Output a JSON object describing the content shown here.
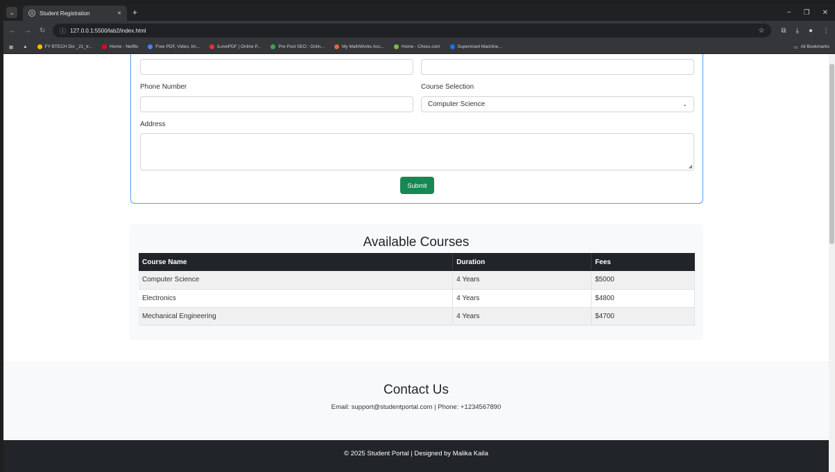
{
  "browser": {
    "tab_title": "Student Registration",
    "url": "127.0.0.1:5500/lab2/index.html",
    "bookmarks": [
      {
        "label": "FY BTECH Div _21_tr...",
        "color": "#fbbc04"
      },
      {
        "label": "Home - Netflix",
        "color": "#e50914"
      },
      {
        "label": "Free PDF, Video, Im...",
        "color": "#4285f4"
      },
      {
        "label": "iLovePDF | Online P...",
        "color": "#e5322d"
      },
      {
        "label": "Pre Post SEO : Onlin...",
        "color": "#34a853"
      },
      {
        "label": "My MathWorks Acc...",
        "color": "#e16737"
      },
      {
        "label": "Home - Chess.com",
        "color": "#81b64c"
      },
      {
        "label": "Supervised Machine...",
        "color": "#1a73e8"
      }
    ],
    "all_bookmarks": "All Bookmarks"
  },
  "form": {
    "phone_label": "Phone Number",
    "course_label": "Course Selection",
    "course_selected": "Computer Science",
    "address_label": "Address",
    "submit_label": "Submit"
  },
  "courses": {
    "title": "Available Courses",
    "headers": [
      "Course Name",
      "Duration",
      "Fees"
    ],
    "rows": [
      [
        "Computer Science",
        "4 Years",
        "$5000"
      ],
      [
        "Electronics",
        "4 Years",
        "$4800"
      ],
      [
        "Mechanical Engineering",
        "4 Years",
        "$4700"
      ]
    ]
  },
  "contact": {
    "title": "Contact Us",
    "info": "Email: support@studentportal.com | Phone: +1234567890"
  },
  "footer": {
    "text": "© 2025 Student Portal | Designed by Malika Kaila"
  },
  "colors": {
    "accent_border": "#4aa3ff",
    "submit_bg": "#198754",
    "dark": "#212529"
  }
}
